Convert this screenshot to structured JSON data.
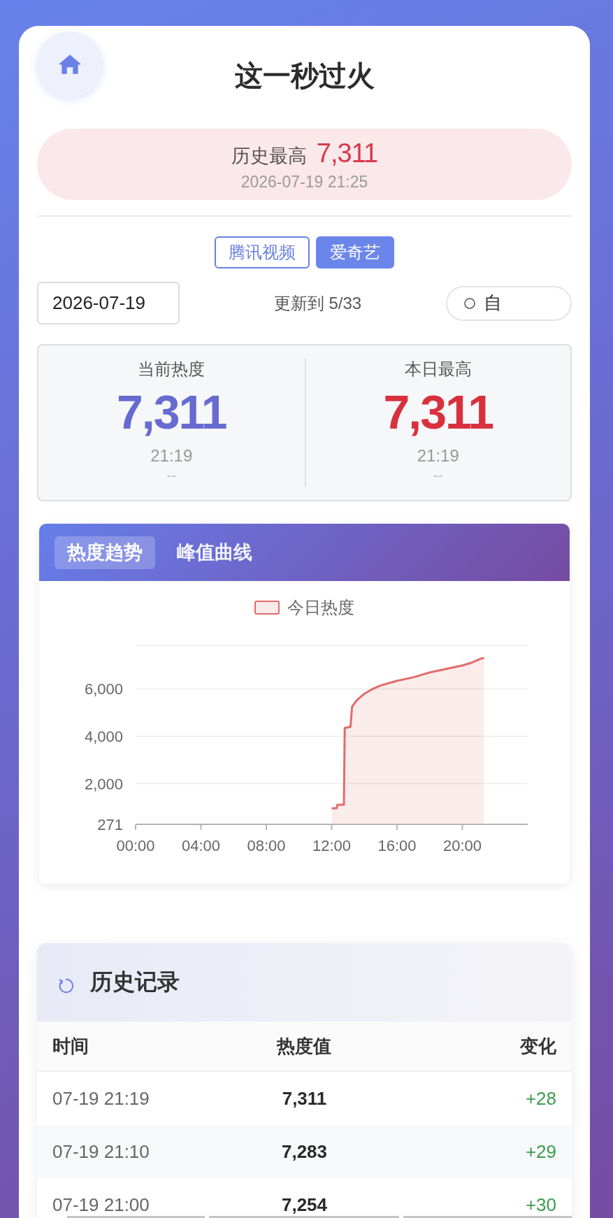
{
  "header": {
    "title": "这一秒过火"
  },
  "record": {
    "label": "历史最高",
    "value": "7,311",
    "time": "2026-07-19 21:25"
  },
  "platform_tabs": [
    {
      "label": "腾讯视频",
      "selected": false
    },
    {
      "label": "爱奇艺",
      "selected": true
    }
  ],
  "controls": {
    "date_field": {
      "value": "2026-07-19"
    },
    "update_status": "更新到 5/33",
    "auto_refresh": {
      "label": "自",
      "checked": false
    }
  },
  "stats": [
    {
      "kind": "current",
      "label": "当前热度",
      "value": "7,311",
      "time": "21:19",
      "change": "--"
    },
    {
      "kind": "peak",
      "label": "本日最高",
      "value": "7,311",
      "time": "21:19",
      "change": "--"
    }
  ],
  "chart_panel": {
    "tabs": [
      {
        "label": "热度趋势",
        "selected": true
      },
      {
        "label": "峰值曲线",
        "selected": false
      }
    ],
    "chart_data": {
      "type": "area",
      "grid": true,
      "x": [
        12,
        12.3,
        12.35,
        12.75,
        12.8,
        13.15,
        13.25,
        13.5,
        14,
        14.5,
        15,
        15.5,
        16,
        17,
        18,
        19,
        20,
        20.5,
        21,
        21.17,
        21.32
      ],
      "series": [
        {
          "name": "今日热度",
          "color": "#e36b6b",
          "values": [
            950,
            950,
            1100,
            1100,
            4350,
            4400,
            5250,
            5500,
            5800,
            6000,
            6150,
            6250,
            6350,
            6500,
            6700,
            6850,
            7000,
            7100,
            7250,
            7300,
            7300
          ]
        }
      ],
      "xlim": [
        0,
        24
      ],
      "ylim": [
        271,
        7850
      ],
      "xticks": [
        {
          "value": 0,
          "label": "00:00"
        },
        {
          "value": 4,
          "label": "04:00"
        },
        {
          "value": 8,
          "label": "08:00"
        },
        {
          "value": 12,
          "label": "12:00"
        },
        {
          "value": 16,
          "label": "16:00"
        },
        {
          "value": 20,
          "label": "20:00"
        }
      ],
      "yticks": [
        {
          "value": 271,
          "label": "271"
        },
        {
          "value": 2000,
          "label": "2,000"
        },
        {
          "value": 4000,
          "label": "4,000"
        },
        {
          "value": 6000,
          "label": "6,000"
        }
      ]
    }
  },
  "history": {
    "title": "历史记录",
    "columns": [
      "时间",
      "热度值",
      "变化"
    ],
    "rows": [
      {
        "time": "07-19 21:19",
        "value": "7,311",
        "change": "+28"
      },
      {
        "time": "07-19 21:10",
        "value": "7,283",
        "change": "+29"
      },
      {
        "time": "07-19 21:00",
        "value": "7,254",
        "change": "+30"
      }
    ]
  }
}
